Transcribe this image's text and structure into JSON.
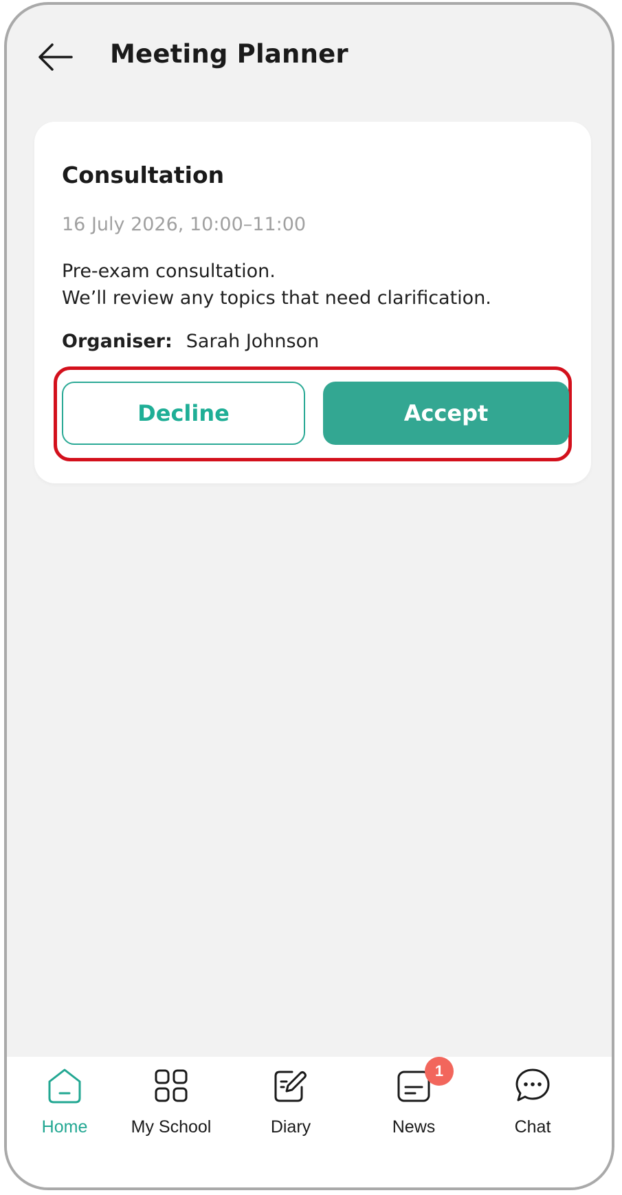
{
  "header": {
    "title": "Meeting Planner",
    "back_icon": "arrow-left-icon"
  },
  "meeting": {
    "title": "Consultation",
    "date": "16 July 2026, 10:00–11:00",
    "description_line1": "Pre-exam consultation.",
    "description_line2": "We’ll review any topics that need clarification.",
    "organiser_label": "Organiser:",
    "organiser_name": "Sarah Johnson"
  },
  "actions": {
    "decline_label": "Decline",
    "accept_label": "Accept"
  },
  "nav": {
    "items": [
      {
        "label": "Home",
        "icon": "home-icon",
        "active": true
      },
      {
        "label": "My School",
        "icon": "grid-icon",
        "active": false
      },
      {
        "label": "Diary",
        "icon": "diary-icon",
        "active": false
      },
      {
        "label": "News",
        "icon": "news-icon",
        "active": false,
        "badge": "1"
      },
      {
        "label": "Chat",
        "icon": "chat-icon",
        "active": false
      }
    ]
  },
  "colors": {
    "accent": "#33a792",
    "highlight": "#d3101c",
    "badge": "#f2665c",
    "background": "#f2f2f2"
  }
}
